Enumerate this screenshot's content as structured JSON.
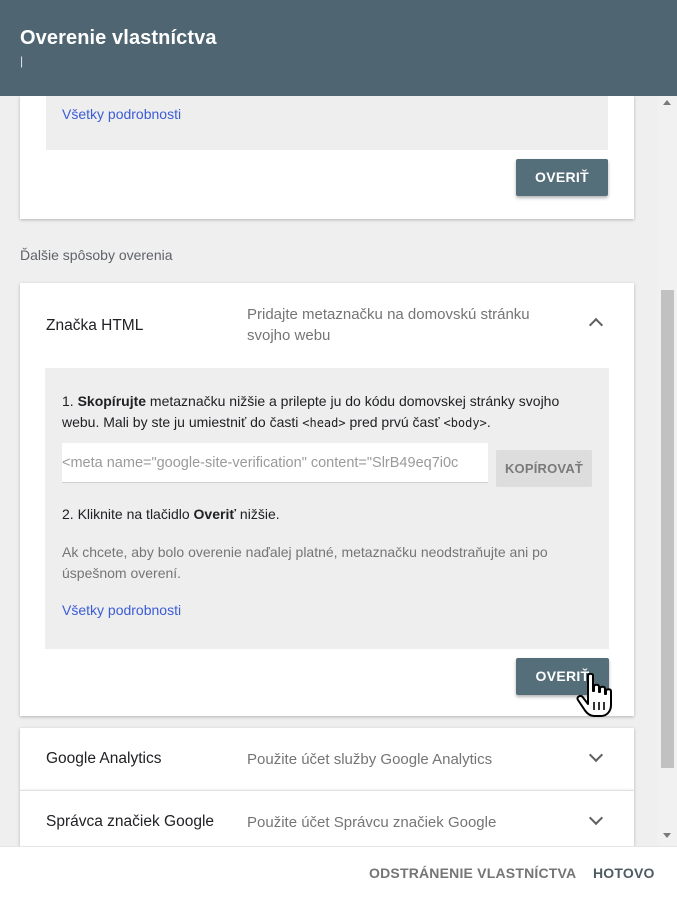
{
  "header": {
    "title": "Overenie vlastníctva",
    "subtitle": "|"
  },
  "top_card": {
    "details_link": "Všetky podrobnosti",
    "verify_label": "OVERIŤ"
  },
  "section_label": "Ďalšie spôsoby overenia",
  "html_tag": {
    "title": "Značka HTML",
    "description": "Pridajte metaznačku na domovskú stránku svojho webu",
    "chevron": "chevron-up-icon",
    "step1_num": "1.",
    "step1_bold": "Skopírujte",
    "step1_text_a": " metaznačku nižšie a prilepte ju do kódu domovskej stránky svojho webu. Mali by ste ju umiestniť do časti ",
    "step1_code_head": "<head>",
    "step1_text_b": " pred prvú časť ",
    "step1_code_body": "<body>",
    "step1_text_c": ".",
    "meta_value": "<meta name=\"google-site-verification\" content=\"SlrB49eq7i0c",
    "copy_label": "KOPÍROVAŤ",
    "step2_num": "2.",
    "step2_text_a": "Kliknite na tlačidlo ",
    "step2_bold": "Overiť",
    "step2_text_b": " nižšie.",
    "note": "Ak chcete, aby bolo overenie naďalej platné, metaznačku neodstraňujte ani po úspešnom overení.",
    "details_link": "Všetky podrobnosti",
    "verify_label": "OVERIŤ"
  },
  "google_analytics": {
    "title": "Google Analytics",
    "description": "Použite účet služby Google Analytics",
    "chevron": "chevron-down-icon"
  },
  "tag_manager": {
    "title": "Správca značiek Google",
    "description": "Použite účet Správcu značiek Google",
    "chevron": "chevron-down-icon"
  },
  "footer": {
    "remove_label": "ODSTRÁNENIE VLASTNÍCTVA",
    "done_label": "HOTOVO"
  },
  "colors": {
    "header_bg": "#4f6572",
    "verify_btn": "#546e7a",
    "link": "#3c5cd6"
  }
}
